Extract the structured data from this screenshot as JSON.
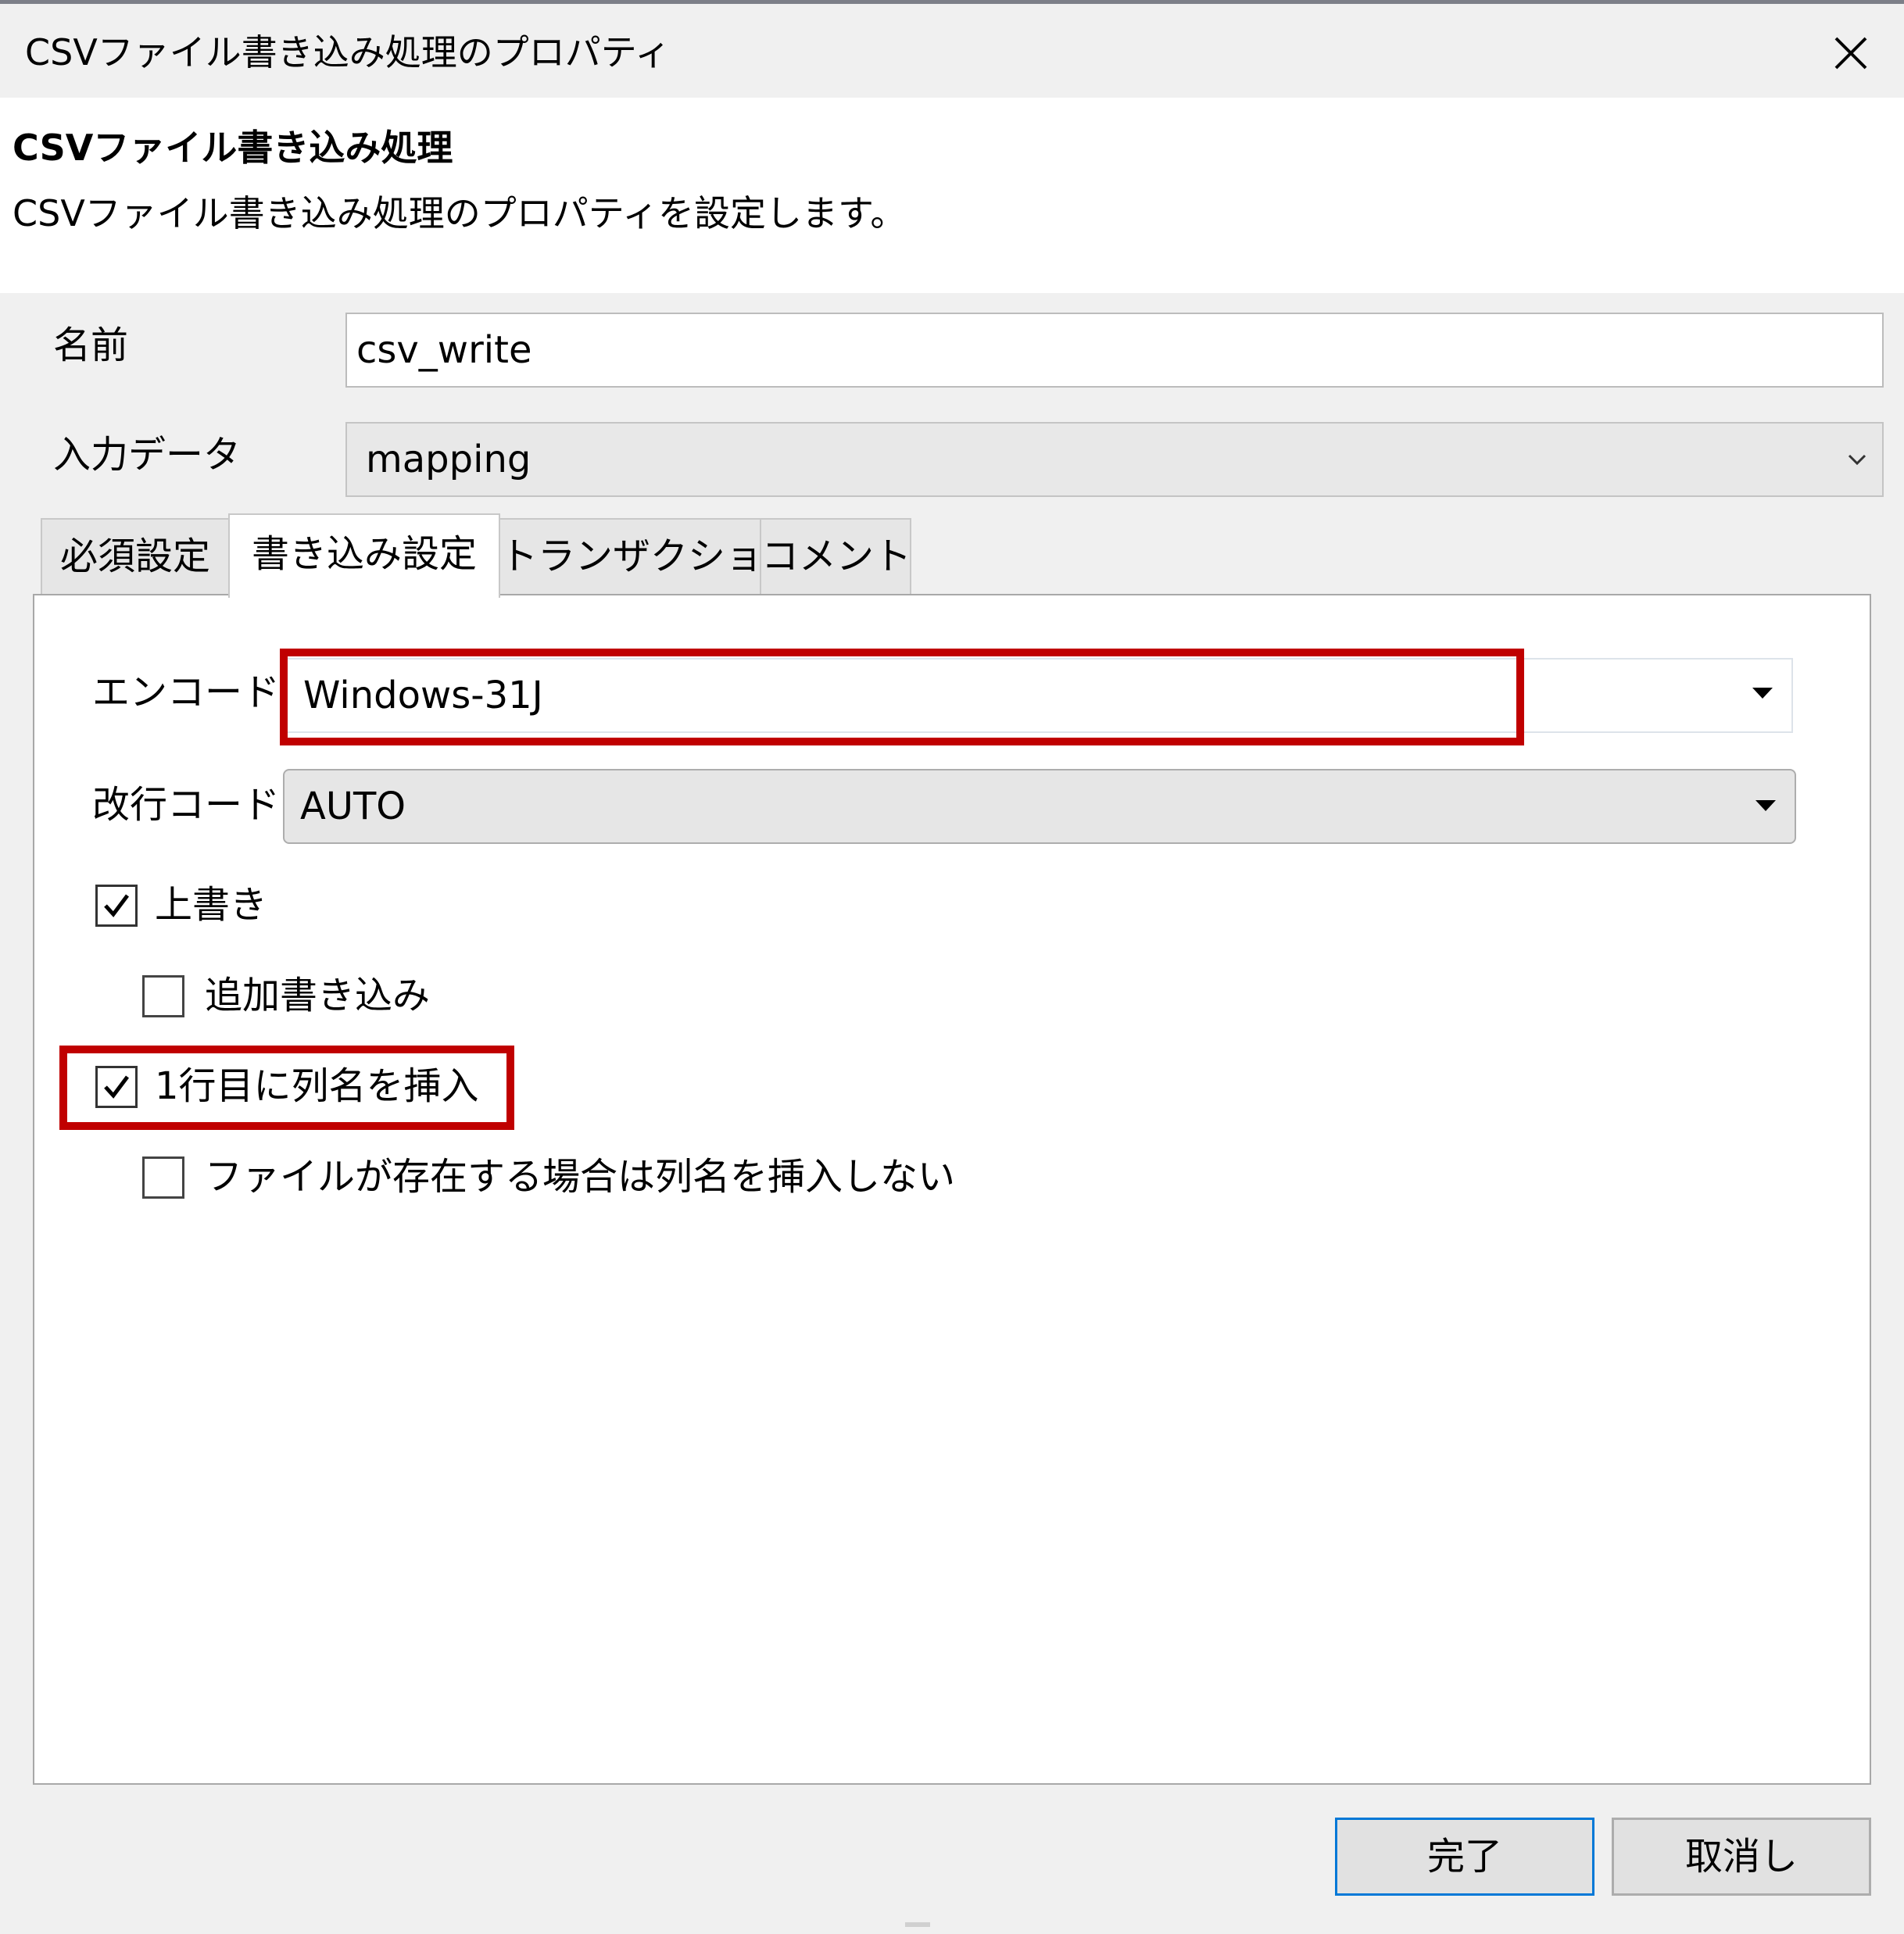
{
  "window": {
    "title": "CSVファイル書き込み処理のプロパティ"
  },
  "header": {
    "title": "CSVファイル書き込み処理",
    "description": "CSVファイル書き込み処理のプロパティを設定します。"
  },
  "fields": {
    "name_label": "名前",
    "name_value": "csv_write",
    "input_data_label": "入力データ",
    "input_data_value": "mapping"
  },
  "tabs": [
    {
      "label": "必須設定",
      "active": false
    },
    {
      "label": "書き込み設定",
      "active": true
    },
    {
      "label": "トランザクション",
      "active": false
    },
    {
      "label": "コメント",
      "active": false
    }
  ],
  "write_settings": {
    "encode_label": "エンコード",
    "encode_value": "Windows-31J",
    "newline_label": "改行コード",
    "newline_value": "AUTO",
    "checkboxes": [
      {
        "label": "上書き",
        "checked": true
      },
      {
        "label": "追加書き込み",
        "checked": false
      },
      {
        "label": "1行目に列名を挿入",
        "checked": true
      },
      {
        "label": "ファイルが存在する場合は列名を挿入しない",
        "checked": false
      }
    ]
  },
  "buttons": {
    "finish": "完了",
    "cancel": "取消し"
  },
  "colors": {
    "highlight": "#c00000",
    "focus_border": "#0078d7"
  },
  "icons": {
    "close": "close-icon",
    "chevron": "chevron-down-icon",
    "dropdown": "dropdown-arrow-icon",
    "check": "checkmark-icon"
  }
}
